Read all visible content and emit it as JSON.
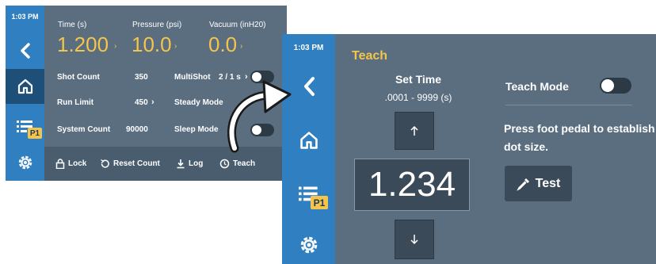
{
  "left_screen": {
    "status_time": "1:03 PM",
    "params": [
      {
        "label": "Time (s)",
        "value": "1.200"
      },
      {
        "label": "Pressure (psi)",
        "value": "10.0"
      },
      {
        "label": "Vacuum (inH20)",
        "value": "0.0"
      }
    ],
    "rows": {
      "shot_count_label": "Shot Count",
      "shot_count_value": "350",
      "run_limit_label": "Run Limit",
      "run_limit_value": "450",
      "system_count_label": "System Count",
      "system_count_value": "90000",
      "multishot_label": "MultiShot",
      "multishot_value": "2 / 1 s",
      "steady_mode_label": "Steady Mode",
      "sleep_mode_label": "Sleep Mode"
    },
    "bottom_bar": {
      "lock": "Lock",
      "reset_count": "Reset Count",
      "log": "Log",
      "teach": "Teach"
    },
    "badge": "P1"
  },
  "right_screen": {
    "status_time": "1:03 PM",
    "title": "Teach",
    "set_time_label": "Set Time",
    "set_time_range": ".0001 - 9999 (s)",
    "value": "1.234",
    "teach_mode_label": "Teach Mode",
    "instruction": "Press foot pedal to establish dot size.",
    "test_label": "Test",
    "badge": "P1"
  },
  "colors": {
    "sidebar": "#2f7fc1",
    "sidebar_active": "#1d4f78",
    "panel": "#5a6e80",
    "accent": "#f4c54a"
  }
}
